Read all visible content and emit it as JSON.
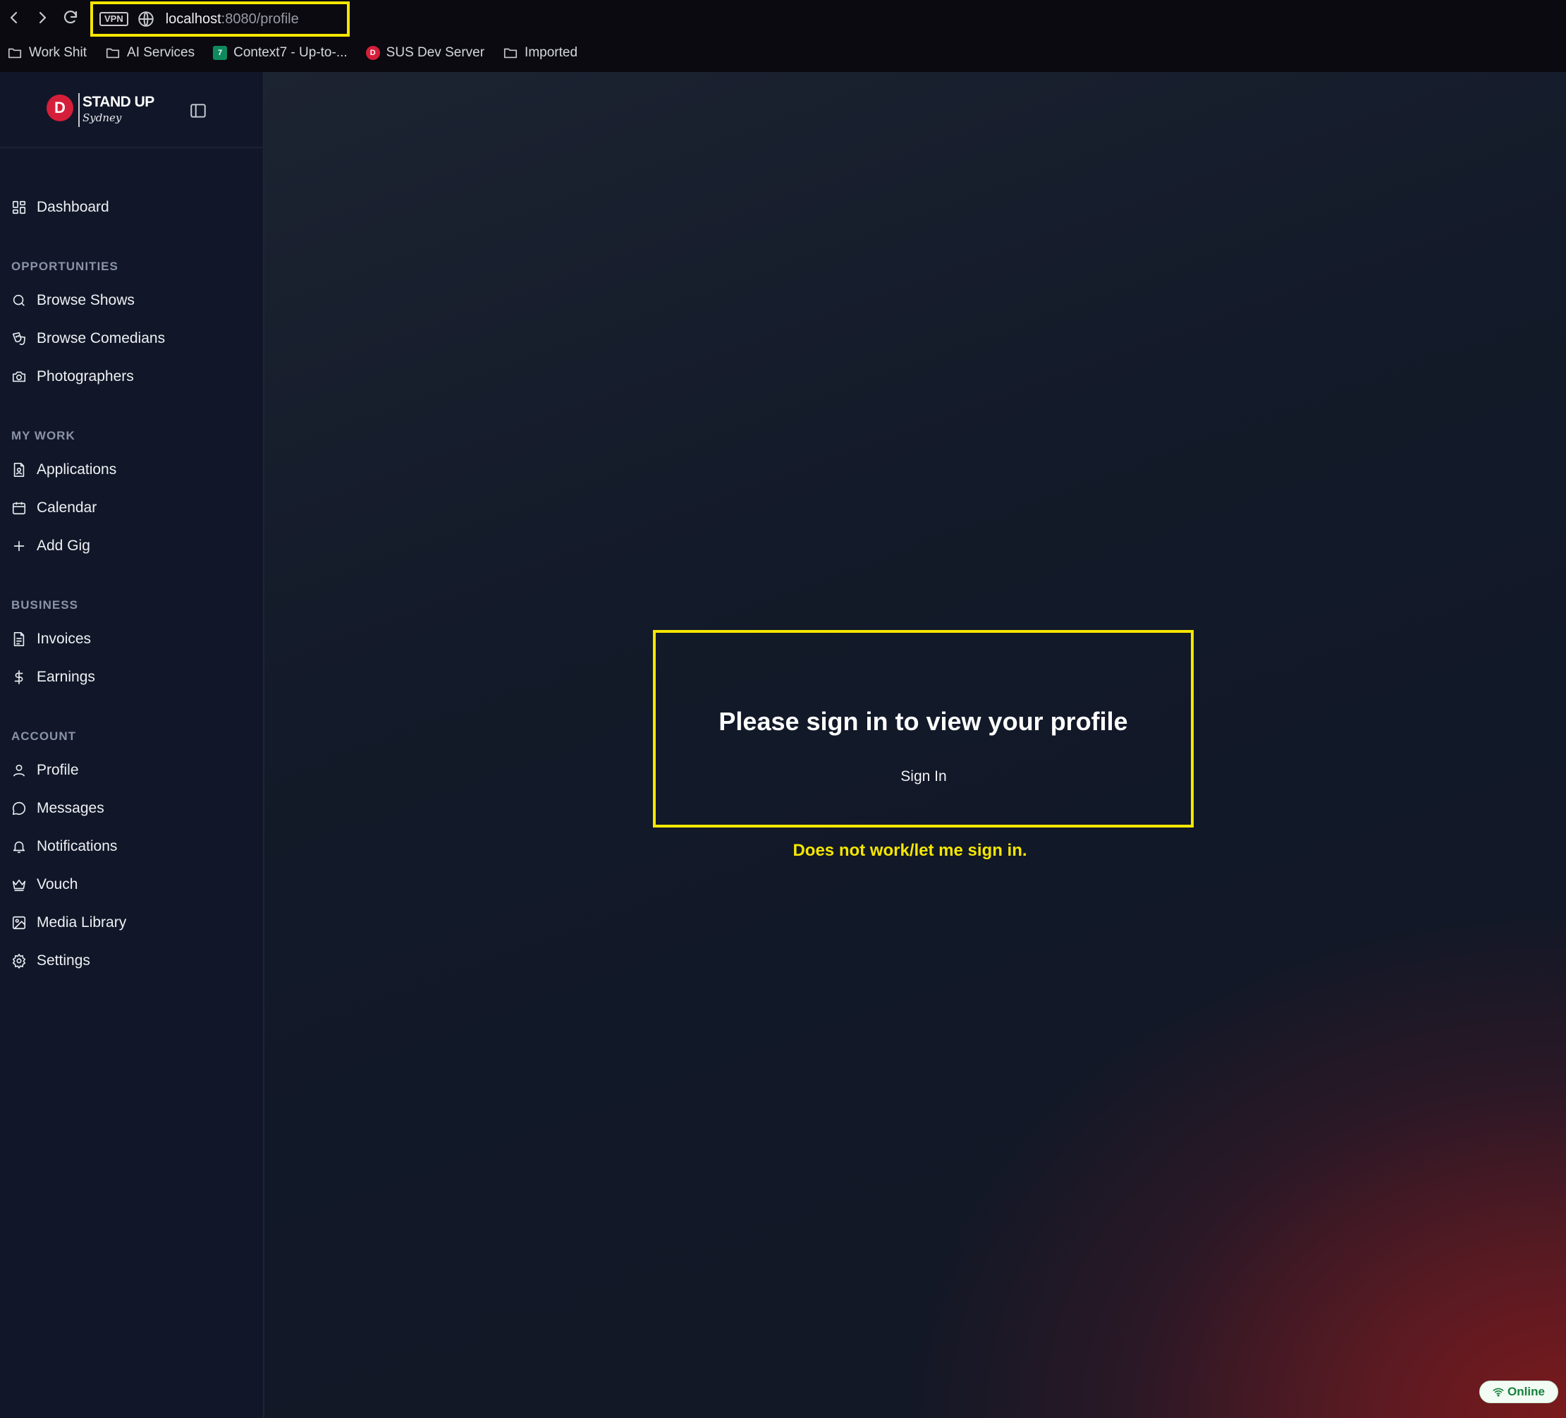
{
  "browser": {
    "vpn_badge": "VPN",
    "url_host": "localhost",
    "url_path": ":8080/profile",
    "bookmarks": [
      {
        "label": "Work Shit",
        "icon": "folder-icon"
      },
      {
        "label": "AI Services",
        "icon": "folder-icon"
      },
      {
        "label": "Context7 - Up-to-...",
        "icon": "context7-favicon"
      },
      {
        "label": "SUS Dev Server",
        "icon": "standup-favicon"
      },
      {
        "label": "Imported",
        "icon": "folder-icon"
      }
    ]
  },
  "sidebar": {
    "logo": {
      "line1": "STAND UP",
      "line2": "Sydney",
      "mark": "D"
    },
    "items_top": [
      {
        "label": "Dashboard",
        "icon": "dashboard-icon"
      }
    ],
    "sections": [
      {
        "title": "OPPORTUNITIES",
        "items": [
          {
            "label": "Browse Shows",
            "icon": "search-icon"
          },
          {
            "label": "Browse Comedians",
            "icon": "theater-masks-icon"
          },
          {
            "label": "Photographers",
            "icon": "camera-icon"
          }
        ]
      },
      {
        "title": "MY WORK",
        "items": [
          {
            "label": "Applications",
            "icon": "file-user-icon"
          },
          {
            "label": "Calendar",
            "icon": "calendar-icon"
          },
          {
            "label": "Add Gig",
            "icon": "plus-icon"
          }
        ]
      },
      {
        "title": "BUSINESS",
        "items": [
          {
            "label": "Invoices",
            "icon": "file-text-icon"
          },
          {
            "label": "Earnings",
            "icon": "dollar-icon"
          }
        ]
      },
      {
        "title": "ACCOUNT",
        "items": [
          {
            "label": "Profile",
            "icon": "user-icon"
          },
          {
            "label": "Messages",
            "icon": "message-icon"
          },
          {
            "label": "Notifications",
            "icon": "bell-icon"
          },
          {
            "label": "Vouch",
            "icon": "crown-icon"
          },
          {
            "label": "Media Library",
            "icon": "image-icon"
          },
          {
            "label": "Settings",
            "icon": "gear-icon"
          }
        ]
      }
    ]
  },
  "main": {
    "title": "Please sign in to view your profile",
    "signin_label": "Sign In",
    "annotation": "Does not work/let me sign in.",
    "status": "Online"
  },
  "colors": {
    "highlight": "#f5e600",
    "sidebar_bg": "#111728",
    "status_green": "#17803d"
  }
}
